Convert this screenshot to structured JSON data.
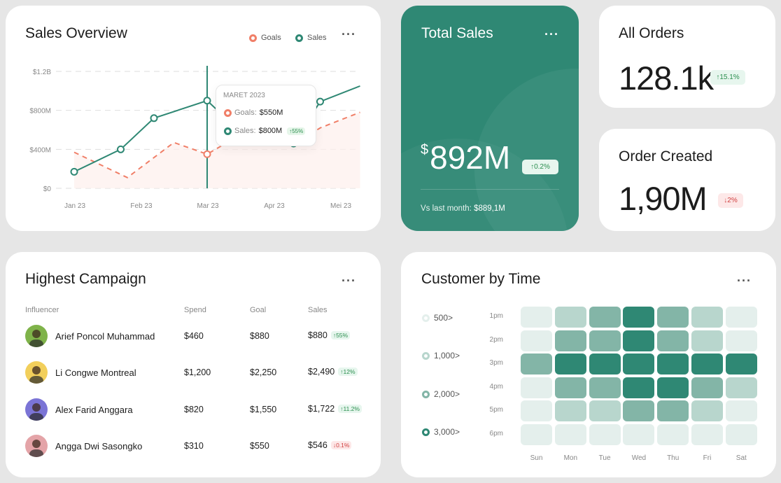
{
  "sales_overview": {
    "title": "Sales Overview",
    "legend": [
      {
        "label": "Goals",
        "color": "#f07f68"
      },
      {
        "label": "Sales",
        "color": "#2f8874"
      }
    ],
    "chart_data": {
      "type": "line",
      "title": "Sales Overview",
      "x_tick_labels": [
        "Jan 23",
        "Feb 23",
        "Mar 23",
        "Apr 23",
        "Mei 23"
      ],
      "y_tick_labels": [
        "$1.2B",
        "$800M",
        "$400M",
        "$0"
      ],
      "ylim": [
        0,
        1200
      ],
      "grid": true,
      "legend_position": "top-right",
      "series": [
        {
          "name": "Sales",
          "color": "#2f8874",
          "x": [
            0,
            0.7,
            1.2,
            2,
            2.5,
            3.3,
            3.7,
            4.3
          ],
          "y": [
            170,
            400,
            720,
            900,
            580,
            460,
            890,
            1050
          ]
        },
        {
          "name": "Goals",
          "color": "#f07f68",
          "x": [
            0,
            0.8,
            1.5,
            2,
            2.5,
            3.3,
            3.7,
            4.3
          ],
          "y": [
            370,
            110,
            470,
            350,
            550,
            450,
            620,
            780
          ]
        }
      ],
      "tooltip": {
        "title": "MARET 2023",
        "goals_label": "Goals:",
        "goals_value": "$550M",
        "sales_label": "Sales:",
        "sales_value": "$800M",
        "sales_badge": "↑55%"
      }
    }
  },
  "total_sales": {
    "title": "Total Sales",
    "currency": "$",
    "value": "892M",
    "badge": "↑0.2%",
    "vs_label": "Vs last month:",
    "vs_value": "$889,1M"
  },
  "all_orders": {
    "title": "All Orders",
    "value": "128.1k",
    "badge": "↑15.1%"
  },
  "order_created": {
    "title": "Order Created",
    "value": "1,90M",
    "badge": "↓2%"
  },
  "campaign": {
    "title": "Highest Campaign",
    "columns": [
      "Influencer",
      "Spend",
      "Goal",
      "Sales"
    ],
    "rows": [
      {
        "name": "Arief Poncol Muhammad",
        "spend": "$460",
        "goal": "$880",
        "sales": "$880",
        "badge": "↑55%",
        "trend": "up",
        "avatar_color": "#7fb34a"
      },
      {
        "name": "Li Congwe Montreal",
        "spend": "$1,200",
        "goal": "$2,250",
        "sales": "$2,490",
        "badge": "↑12%",
        "trend": "up",
        "avatar_color": "#f2cf5b"
      },
      {
        "name": "Alex Farid Anggara",
        "spend": "$820",
        "goal": "$1,550",
        "sales": "$1,722",
        "badge": "↑11.2%",
        "trend": "up",
        "avatar_color": "#7b74d6"
      },
      {
        "name": "Angga Dwi Sasongko",
        "spend": "$310",
        "goal": "$550",
        "sales": "$546",
        "badge": "↓0.1%",
        "trend": "down",
        "avatar_color": "#e4a4a8"
      }
    ]
  },
  "customer_by_time": {
    "title": "Customer by Time",
    "legend": [
      "500>",
      "1,000>",
      "2,000>",
      "3,000>"
    ],
    "legend_colors": [
      "#e4efec",
      "#b8d6cd",
      "#83b5a7",
      "#2f8874"
    ],
    "chart_data": {
      "type": "heatmap",
      "title": "Customer by Time",
      "rows": [
        "1pm",
        "2pm",
        "3pm",
        "4pm",
        "5pm",
        "6pm"
      ],
      "columns": [
        "Sun",
        "Mon",
        "Tue",
        "Wed",
        "Thu",
        "Fri",
        "Sat"
      ],
      "levels": [
        [
          0,
          1,
          2,
          3,
          2,
          1,
          0
        ],
        [
          0,
          2,
          2,
          3,
          2,
          1,
          0
        ],
        [
          2,
          3,
          3,
          3,
          3,
          3,
          3
        ],
        [
          0,
          2,
          2,
          3,
          3,
          2,
          1
        ],
        [
          0,
          1,
          1,
          2,
          2,
          1,
          0
        ],
        [
          0,
          0,
          0,
          0,
          0,
          0,
          0
        ]
      ],
      "level_legend": [
        "500>",
        "1,000>",
        "2,000>",
        "3,000>"
      ]
    }
  }
}
